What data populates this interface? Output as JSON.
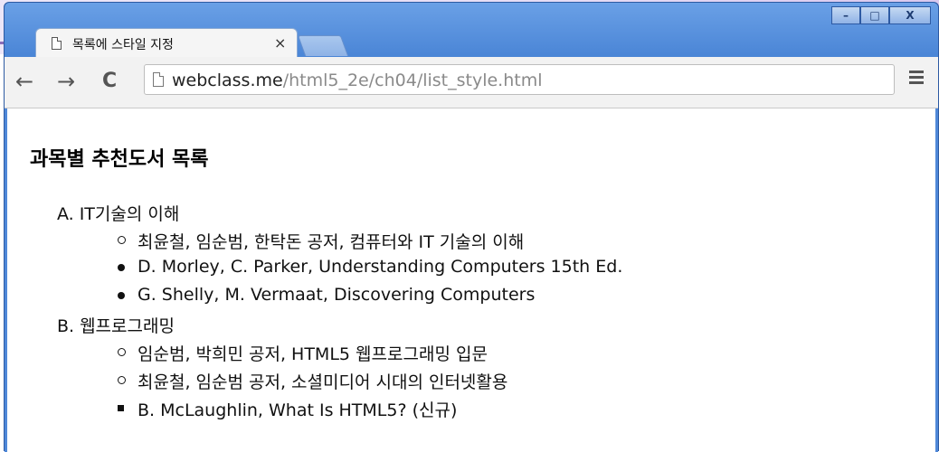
{
  "browser": {
    "tab_title": "목록에 스타일 지정",
    "tab_close": "×",
    "url_host": "webclass.me",
    "url_path": "/html5_2e/ch04/list_style.html",
    "window_minimize": "–",
    "window_maximize": "□",
    "window_close": "X",
    "back": "←",
    "forward": "→",
    "reload": "C"
  },
  "page": {
    "heading": "과목별 추천도서 목록",
    "sections": [
      {
        "marker": "A.",
        "title": "IT기술의 이해",
        "items": [
          {
            "style": "circle",
            "text": "최윤철, 임순범, 한탁돈 공저, 컴퓨터와 IT 기술의 이해"
          },
          {
            "style": "disc",
            "text": "D. Morley, C. Parker, Understanding Computers 15th Ed."
          },
          {
            "style": "disc",
            "text": "G. Shelly, M. Vermaat, Discovering Computers"
          }
        ]
      },
      {
        "marker": "B.",
        "title": "웹프로그래밍",
        "items": [
          {
            "style": "circle",
            "text": "임순범, 박희민 공저, HTML5 웹프로그래밍 입문"
          },
          {
            "style": "circle",
            "text": "최윤철, 임순범 공저, 소셜미디어 시대의 인터넷활용"
          },
          {
            "style": "square",
            "text": "B. McLaughlin, What Is HTML5? (신규)"
          }
        ]
      }
    ]
  }
}
